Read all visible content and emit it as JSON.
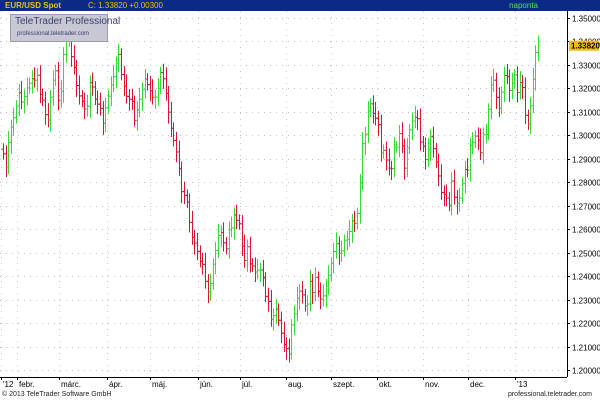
{
  "header": {
    "title": "EUR/USD Spot",
    "change_label": "C: 1.33820 +0.00300",
    "period": "naponta"
  },
  "watermark": {
    "brand": "TeleTrader Professional",
    "url": "professional.teletrader.com"
  },
  "footer": {
    "copyright": "© 2013 TeleTrader Software GmbH",
    "url": "professional.teletrader.com"
  },
  "colors": {
    "header_bg": "#0a2a86",
    "header_text": "#f0c000",
    "up": "#33dd33",
    "down": "#dd1133",
    "last_box": "#f0c000"
  },
  "chart_data": {
    "type": "ohlc",
    "title": "EUR/USD Spot",
    "ylim": [
      1.2,
      1.35
    ],
    "y_ticks": [
      "1.20000",
      "1.21000",
      "1.22000",
      "1.23000",
      "1.24000",
      "1.25000",
      "1.26000",
      "1.27000",
      "1.28000",
      "1.29000",
      "1.30000",
      "1.31000",
      "1.32000",
      "1.33000",
      "1.34000",
      "1.35000"
    ],
    "x_ticks": [
      "'12",
      "febr.",
      "márc.",
      "ápr.",
      "máj.",
      "jún.",
      "júl.",
      "aug.",
      "szept.",
      "okt.",
      "nov.",
      "dec.",
      "'13"
    ],
    "last_value": "1.33820",
    "grid": true,
    "series": [
      {
        "values_close": [
          1.2921,
          1.2865,
          1.297,
          1.3035,
          1.3075,
          1.3125,
          1.3182,
          1.3142,
          1.3165,
          1.3202,
          1.3222,
          1.3241,
          1.3235,
          1.3256,
          1.3174,
          1.315,
          1.3088,
          1.3065,
          1.3163,
          1.3235,
          1.3275,
          1.315,
          1.3188,
          1.3345,
          1.3402,
          1.3457,
          1.3335,
          1.329,
          1.3212,
          1.3168,
          1.3145,
          1.3112,
          1.3124,
          1.3224,
          1.3206,
          1.3154,
          1.3133,
          1.3115,
          1.3051,
          1.3117,
          1.3167,
          1.3215,
          1.325,
          1.3306,
          1.3345,
          1.3259,
          1.321,
          1.3166,
          1.3154,
          1.3145,
          1.3063,
          1.3109,
          1.3154,
          1.3194,
          1.324,
          1.3216,
          1.319,
          1.3162,
          1.3163,
          1.32,
          1.3268,
          1.3241,
          1.3179,
          1.3099,
          1.303,
          1.2978,
          1.2929,
          1.2858,
          1.276,
          1.2744,
          1.2715,
          1.2629,
          1.2565,
          1.2541,
          1.2506,
          1.2463,
          1.245,
          1.2378,
          1.2334,
          1.2368,
          1.2451,
          1.2509,
          1.2573,
          1.2586,
          1.2542,
          1.2517,
          1.2597,
          1.2605,
          1.2661,
          1.2638,
          1.2623,
          1.2528,
          1.2467,
          1.2525,
          1.2452,
          1.2443,
          1.2418,
          1.2425,
          1.2426,
          1.2393,
          1.2314,
          1.2292,
          1.2216,
          1.2232,
          1.2259,
          1.2212,
          1.2157,
          1.2108,
          1.2091,
          1.2069,
          1.2192,
          1.2239,
          1.2305,
          1.2336,
          1.232,
          1.2273,
          1.2281,
          1.2378,
          1.233,
          1.2395,
          1.2336,
          1.2302,
          1.2316,
          1.2356,
          1.2403,
          1.2455,
          1.2505,
          1.2538,
          1.2497,
          1.2508,
          1.2553,
          1.2556,
          1.259,
          1.2635,
          1.2625,
          1.2667,
          1.2798,
          1.2965,
          1.3005,
          1.3103,
          1.3134,
          1.3093,
          1.3073,
          1.3045,
          1.2925,
          1.2936,
          1.2895,
          1.286,
          1.2858,
          1.295,
          1.295,
          1.3007,
          1.2955,
          1.286,
          1.2946,
          1.3023,
          1.3061,
          1.3077,
          1.3071,
          1.2972,
          1.2954,
          1.2897,
          1.2939,
          1.2994,
          1.2943,
          1.2886,
          1.2827,
          1.2756,
          1.2748,
          1.2733,
          1.2702,
          1.2805,
          1.2736,
          1.2711,
          1.2733,
          1.2796,
          1.2854,
          1.2852,
          1.2957,
          1.2971,
          1.2997,
          1.298,
          1.2926,
          1.3003,
          1.3004,
          1.3111,
          1.3215,
          1.3235,
          1.3162,
          1.3115,
          1.3184,
          1.3255,
          1.325,
          1.3191,
          1.3223,
          1.3257,
          1.3183,
          1.3225,
          1.3204,
          1.3085,
          1.3048,
          1.3126,
          1.3239,
          1.3353,
          1.3382
        ]
      }
    ]
  }
}
